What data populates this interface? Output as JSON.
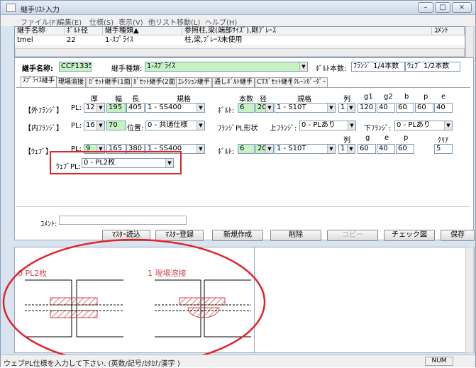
{
  "window": {
    "title": "継手ﾘｽﾄ入力",
    "controls": [
      "–",
      "□",
      "×"
    ]
  },
  "menu": [
    "ファイル(F)",
    "編集(E)",
    "仕様(S)",
    "表示(V)",
    "他リスト移動(L)",
    "ヘルプ(H)"
  ],
  "list": {
    "headers": [
      "継手名称",
      "ﾎﾞﾙﾄ径",
      "継手種類▲",
      "参照柱,梁(端部ｻｲｽﾞ),剛ﾌﾞﾚｰｽ",
      "ｺﾒﾝﾄ"
    ],
    "row": [
      "tmel",
      "22",
      "1-ｽﾌﾟﾗｲｽ",
      "柱,梁,ﾌﾞﾚｰｽ未使用",
      ""
    ]
  },
  "form": {
    "name_label": "継手名称:",
    "name_value": "CCF1335",
    "type_label": "継手種類:",
    "type_value": "1-ｽﾌﾟﾗｲｽ",
    "bolt_label": "ﾎﾞﾙﾄ本数:",
    "bolt_flange": "ﾌﾗﾝｼﾞ 1/4本数",
    "bolt_web": "ｳｪﾌﾞ 1/2本数"
  },
  "tabs": [
    "ｽﾌﾟﾗｲｽ継手",
    "現場溶接",
    "ｶﾞｾｯﾄ継手(1面)",
    "ｶﾞｾｯﾄ継手(2面)",
    "ｴﾚｸｼｮﾝ継手",
    "通しﾎﾞﾙﾄ継手",
    "CTｶﾞｾｯﾄ継手",
    "ｸﾚｰﾝｶﾞｰﾀﾞｰ"
  ],
  "cols": {
    "thick": "厚",
    "width": "幅",
    "length": "長",
    "spec": "規格",
    "count": "本数",
    "dia": "径",
    "spec2": "規格",
    "row": "列",
    "g1": "g1",
    "g2": "g2",
    "b": "b",
    "p": "p",
    "e": "e"
  },
  "outer": {
    "label": "【外ﾌﾗﾝｼﾞ】",
    "pl": "PL:",
    "thick": "12",
    "width": "195",
    "length": "405",
    "spec": "1 - SS400",
    "bolt": "ﾎﾞﾙﾄ:",
    "count": "6",
    "dia": "20",
    "bspec": "1 - S10T",
    "rows": "1",
    "g1": "120",
    "g2": "40",
    "b": "60",
    "p": "60",
    "e": "40"
  },
  "inner": {
    "label": "【内ﾌﾗﾝｼﾞ】",
    "pl": "PL:",
    "thick": "16",
    "width": "70",
    "pos_label": "位置:",
    "pos": "0 - 共通仕様",
    "shape_label": "ﾌﾗﾝｼﾞPL形状",
    "upper_label": "上ﾌﾗﾝｼﾞ:",
    "upper": "0 - PLあり",
    "lower_label": "下ﾌﾗﾝｼﾞ:",
    "lower": "0 - PLあり"
  },
  "web_cols": {
    "row": "列",
    "g": "g",
    "e": "e",
    "p": "p",
    "clear": "ｸﾘｱ"
  },
  "web": {
    "label": "【ｳｪﾌﾞ】",
    "pl": "PL:",
    "thick": "9",
    "width": "165",
    "length": "380",
    "spec": "1 - SS400",
    "bolt": "ﾎﾞﾙﾄ:",
    "count": "6",
    "dia": "20",
    "bspec": "1 - S10T",
    "rows": "1",
    "g": "60",
    "e": "40",
    "p": "60",
    "clear": "5"
  },
  "web_pl": {
    "label": "ｳｪﾌﾞPL:",
    "value": "0 - PL2枚"
  },
  "comment_label": "ｺﾒﾝﾄ:",
  "buttons": [
    "ﾏｽﾀｰ読込",
    "ﾏｽﾀｰ登録",
    "新規作成",
    "削除",
    "コピー",
    "チェック図",
    "保存"
  ],
  "preview": {
    "left_caption": "0 PL2枚",
    "right_caption": "1 現場溶接"
  },
  "status": {
    "text": "ウェブPL仕様を入力して下さい. (英数/記号/ｶﾀｶﾅ/漢字 )",
    "num": "NUM"
  },
  "colors": {
    "accent_red": "#e2232a",
    "field_green": "#c7f2c3",
    "hatch_red": "#d2464e"
  }
}
